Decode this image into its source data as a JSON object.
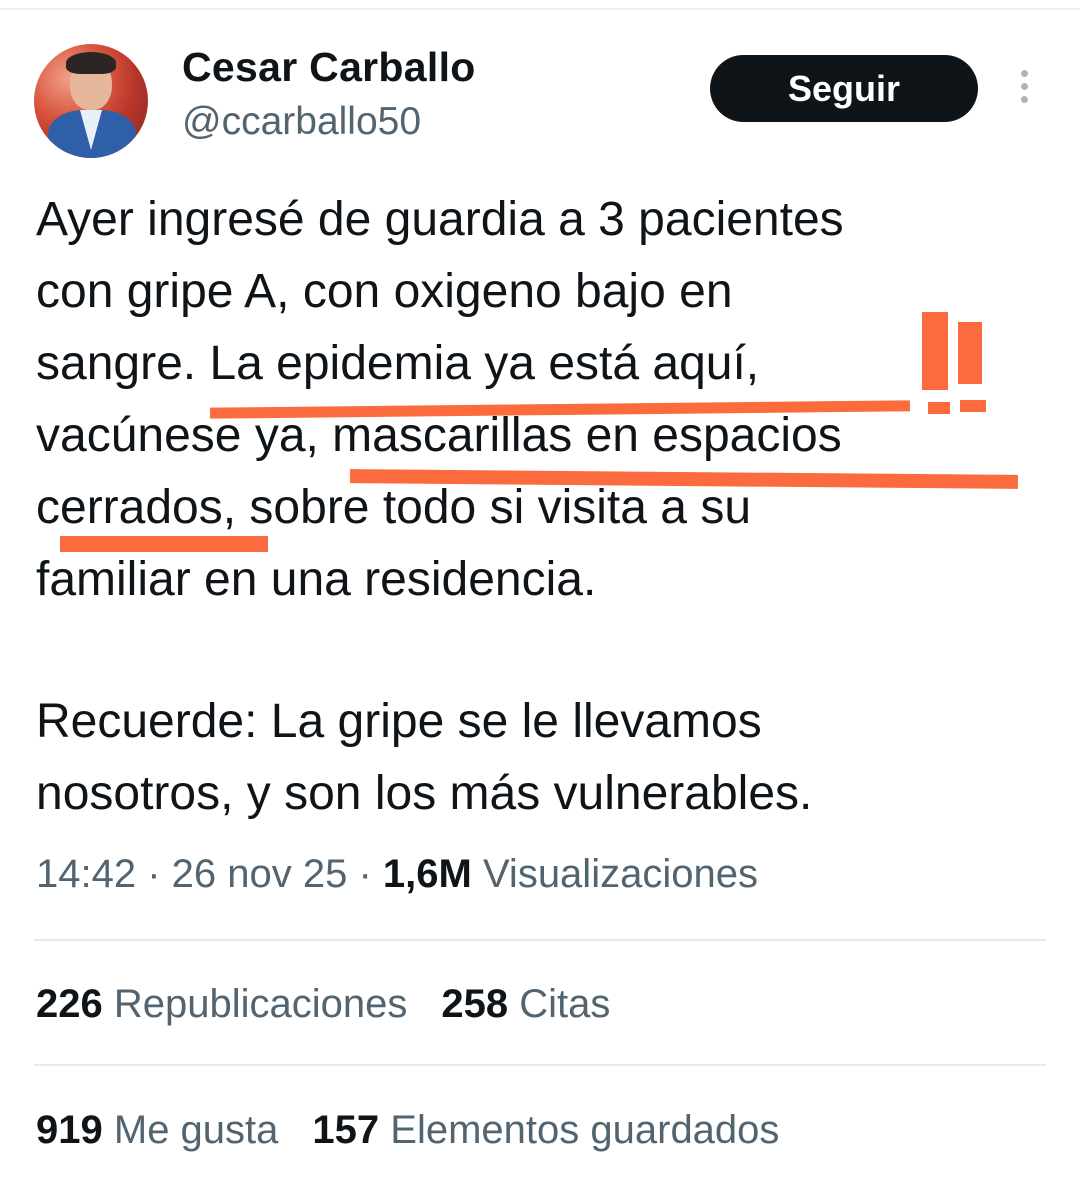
{
  "author": {
    "name": "Cesar Carballo",
    "handle": "@ccarballo50"
  },
  "follow_label": "Seguir",
  "tweet": {
    "lines_1": [
      "Ayer ingresé de guardia a 3 pacientes",
      "con gripe A, con oxigeno bajo en",
      "sangre. La epidemia ya está aquí,",
      "vacúnese ya, mascarillas en espacios",
      "cerrados, sobre todo si visita a su",
      "familiar en una residencia."
    ],
    "lines_2": [
      "Recuerde: La gripe se le llevamos",
      "nosotros, y son los más vulnerables."
    ]
  },
  "meta": {
    "time": "14:42",
    "date": "26 nov 25",
    "views_count": "1,6M",
    "views_label": "Visualizaciones"
  },
  "stats": {
    "reposts_count": "226",
    "reposts_label": "Republicaciones",
    "quotes_count": "258",
    "quotes_label": "Citas",
    "likes_count": "919",
    "likes_label": "Me gusta",
    "bookmarks_count": "157",
    "bookmarks_label": "Elementos guardados"
  },
  "colors": {
    "highlight": "#fb6b3d",
    "follow_bg": "#0f1419",
    "secondary_text": "#536471"
  },
  "icons": [
    "avatar-photo",
    "more-options-icon"
  ]
}
